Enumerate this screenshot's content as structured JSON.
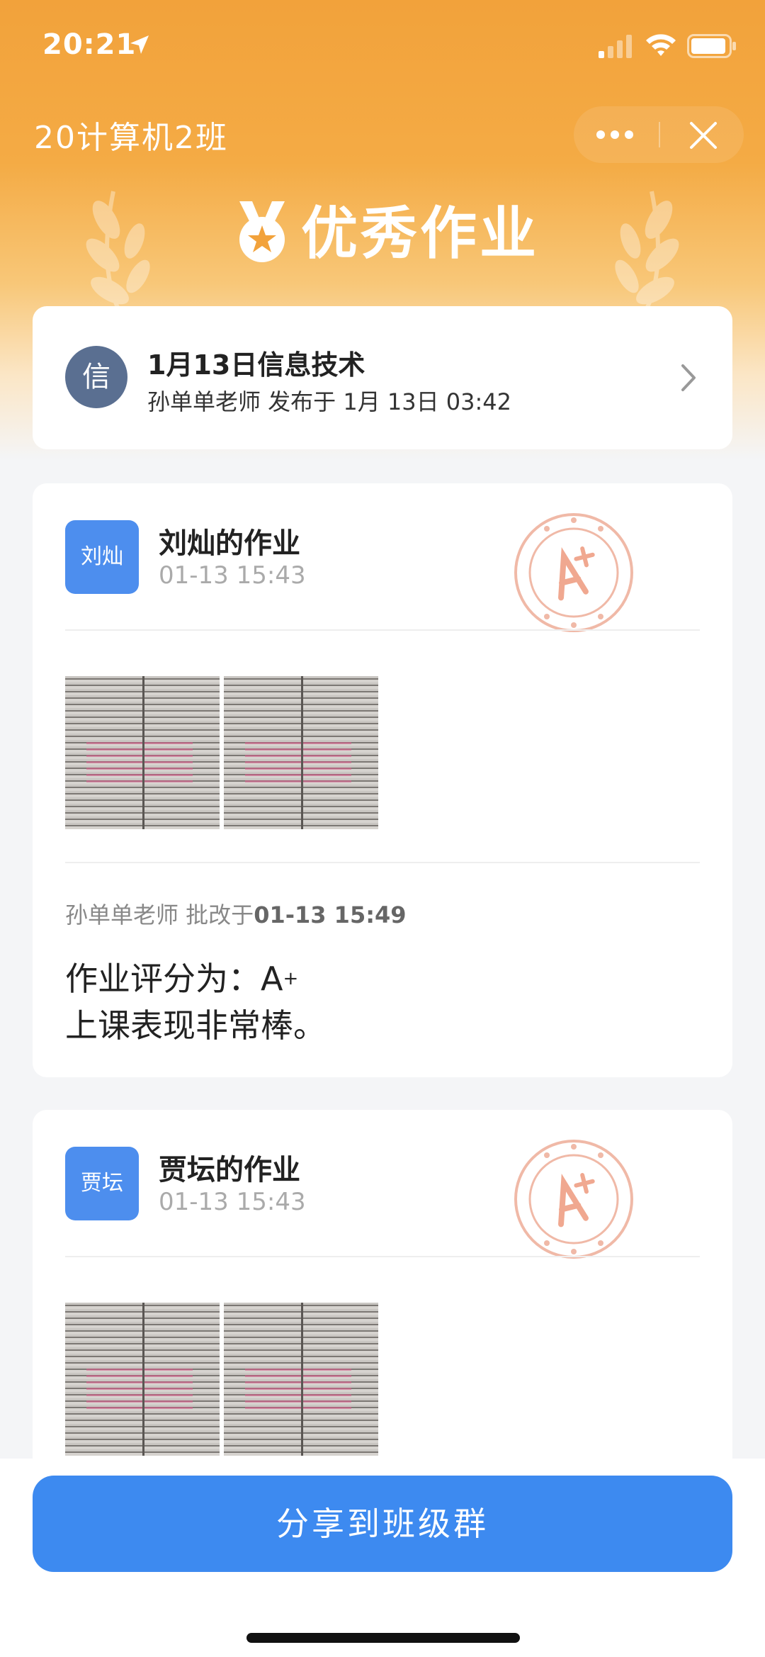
{
  "status_bar": {
    "time": "20:21"
  },
  "header": {
    "title": "20计算机2班",
    "banner": "优秀作业"
  },
  "assignment": {
    "avatar_text": "信",
    "title": "1月13日信息技术",
    "subtitle": "孙单单老师 发布于 1月 13日 03:42"
  },
  "homework": [
    {
      "avatar": "刘灿",
      "title": "刘灿的作业",
      "time": "01-13 15:43",
      "review_prefix": "孙单单老师 批改于",
      "review_time": "01-13 15:49",
      "grade_label": "作业评分为：",
      "grade": "A",
      "grade_sup": "+",
      "comment": "上课表现非常棒。"
    },
    {
      "avatar": "贾坛",
      "title": "贾坛的作业",
      "time": "01-13 15:43"
    }
  ],
  "footer": {
    "share_label": "分享到班级群"
  },
  "colors": {
    "header": "#f2a23b",
    "accent": "#3d8af0",
    "avatar_blue": "#4d8eee",
    "stamp": "#f0b9a7"
  }
}
